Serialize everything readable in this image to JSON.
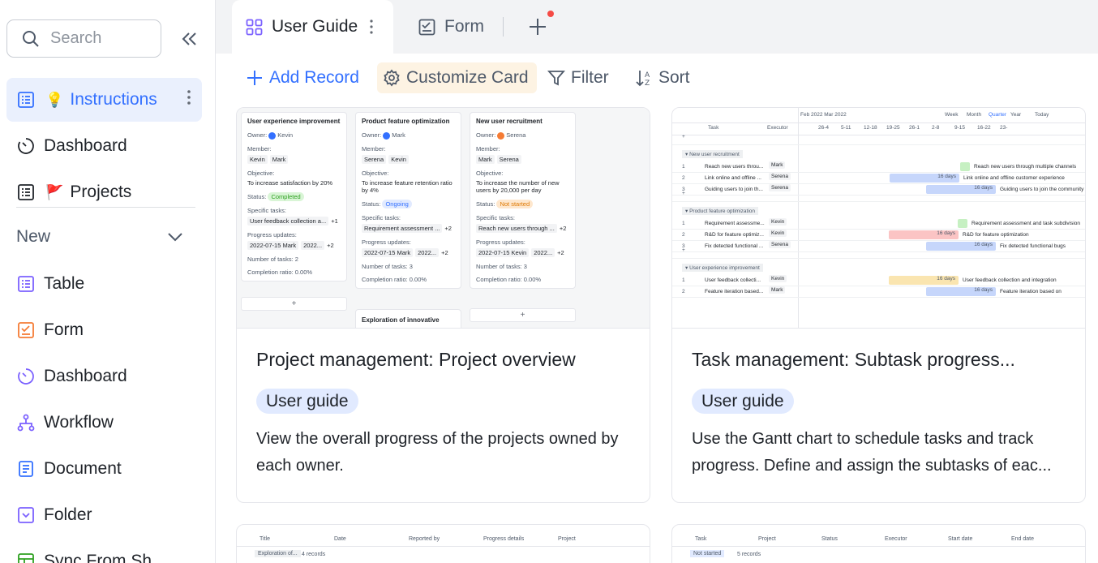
{
  "sidebar": {
    "search_placeholder": "Search",
    "items": [
      {
        "label": "Instructions",
        "emoji": "💡",
        "icon": "table-icon"
      },
      {
        "label": "Dashboard",
        "icon": "dashboard-icon"
      },
      {
        "label": "Projects",
        "emoji": "🚩",
        "icon": "table-icon"
      }
    ],
    "section_label": "New",
    "new_items": [
      {
        "label": "Table",
        "icon": "table-icon",
        "color": "#7b61ff"
      },
      {
        "label": "Form",
        "icon": "form-icon",
        "color": "#f57c35"
      },
      {
        "label": "Dashboard",
        "icon": "dashboard-icon",
        "color": "#7b61ff"
      },
      {
        "label": "Workflow",
        "icon": "workflow-icon",
        "color": "#7b61ff"
      },
      {
        "label": "Document",
        "icon": "document-icon",
        "color": "#3370ff"
      },
      {
        "label": "Folder",
        "icon": "folder-icon",
        "color": "#7b61ff"
      },
      {
        "label": "Sync From Sh",
        "icon": "sync-icon",
        "color": "#2ea121"
      }
    ]
  },
  "tabs": [
    {
      "label": "User Guide",
      "icon": "gallery-icon"
    },
    {
      "label": "Form",
      "icon": "form-icon"
    }
  ],
  "toolbar": {
    "add_record": "Add Record",
    "customize_card": "Customize Card",
    "filter": "Filter",
    "sort": "Sort"
  },
  "cards": [
    {
      "title": "Project management: Project overview",
      "tag": "User guide",
      "description": "View the overall progress of the projects owned by each owner."
    },
    {
      "title": "Task management: Subtask progress...",
      "tag": "User guide",
      "description": "Use the Gantt chart to schedule tasks and track progress. Define and assign the subtasks of eac..."
    }
  ],
  "kanban_preview": {
    "columns": [
      {
        "title": "User experience improvement",
        "owner": "Kevin",
        "owner_color": "#3370ff",
        "members": [
          "Kevin",
          "Mark"
        ],
        "objective": "To increase satisfaction by 20%",
        "status": "Completed",
        "status_bg": "#d9f5d6",
        "status_fg": "#2ea121",
        "task": "User feedback collection a...",
        "task_more": "+1",
        "update": "2022-07-15 Mark",
        "update2": "2022...",
        "update_more": "+2",
        "tasks_count": "2",
        "ratio": "0.00%"
      },
      {
        "title": "Product feature optimization",
        "owner": "Mark",
        "owner_color": "#3370ff",
        "members": [
          "Serena",
          "Kevin"
        ],
        "objective": "To increase feature retention ratio by 4%",
        "status": "Ongoing",
        "status_bg": "#e1eaff",
        "status_fg": "#3370ff",
        "task": "Requirement assessment ...",
        "task_more": "+2",
        "update": "2022-07-15 Mark",
        "update2": "2022...",
        "update_more": "+2",
        "tasks_count": "3",
        "ratio": "0.00%"
      },
      {
        "title": "New user recruitment",
        "owner": "Serena",
        "owner_color": "#f57c35",
        "members": [
          "Mark",
          "Serena"
        ],
        "objective": "To increase the number of new users by 20,000 per day",
        "status": "Not started",
        "status_bg": "#fee7cd",
        "status_fg": "#de7802",
        "task": "Reach new users through ...",
        "task_more": "+2",
        "update": "2022-07-15 Kevin",
        "update2": "2022...",
        "update_more": "+2",
        "tasks_count": "3",
        "ratio": "0.00%"
      }
    ],
    "labels": {
      "owner": "Owner:",
      "member": "Member:",
      "objective": "Objective:",
      "status": "Status:",
      "specific": "Specific tasks:",
      "progress": "Progress updates:",
      "num": "Number of tasks:",
      "ratio": "Completion ratio:"
    },
    "extra_col_title": "Exploration of innovative",
    "add": "+"
  },
  "gantt_preview": {
    "months": "Feb 2022 Mar 2022",
    "views": [
      "Week",
      "Month",
      "Quarter",
      "Year",
      "Today"
    ],
    "col_task": "Task",
    "col_exec": "Executor",
    "weeks": [
      "26-4",
      "5-11",
      "12-18",
      "19-25",
      "26-1",
      "2-8",
      "9-15",
      "16-22",
      "23-"
    ],
    "groups": [
      {
        "name": "New user recruitment",
        "rows": [
          {
            "n": "1",
            "task": "Reach new users throu...",
            "exec": "Mark",
            "label": "Reach new users through multiple channels"
          },
          {
            "n": "2",
            "task": "Link online and offline ...",
            "exec": "Serena",
            "label": "Link online and offline customer experience",
            "days": "16 days"
          },
          {
            "n": "3",
            "task": "Guiding users to join th...",
            "exec": "Serena",
            "label": "Guiding users to join the community",
            "days": "16 days"
          }
        ]
      },
      {
        "name": "Product feature optimization",
        "rows": [
          {
            "n": "1",
            "task": "Requirement assessme...",
            "exec": "Kevin",
            "label": "Requirement assessment and task subdivision"
          },
          {
            "n": "2",
            "task": "R&D for feature optimiz...",
            "exec": "Kevin",
            "label": "R&D for feature optimization",
            "days": "16 days"
          },
          {
            "n": "3",
            "task": "Fix detected functional ...",
            "exec": "Serena",
            "label": "Fix detected functional bugs",
            "days": "16 days"
          }
        ]
      },
      {
        "name": "User experience improvement",
        "rows": [
          {
            "n": "1",
            "task": "User feedback collecti...",
            "exec": "Kevin",
            "label": "User feedback collection and integration",
            "days": "16 days"
          },
          {
            "n": "2",
            "task": "Feature iteration based...",
            "exec": "Mark",
            "label": "Feature iteration based on",
            "days": "16 days"
          }
        ]
      }
    ]
  },
  "bottom_previews": [
    {
      "cols": [
        "Title",
        "Date",
        "Reported by",
        "Progress details",
        "Project"
      ],
      "group": "Exploration of...",
      "count": "4 records"
    },
    {
      "cols": [
        "Task",
        "Project",
        "Status",
        "Executor",
        "Start date",
        "End date"
      ],
      "group": "Not started",
      "count": "5 records"
    }
  ]
}
